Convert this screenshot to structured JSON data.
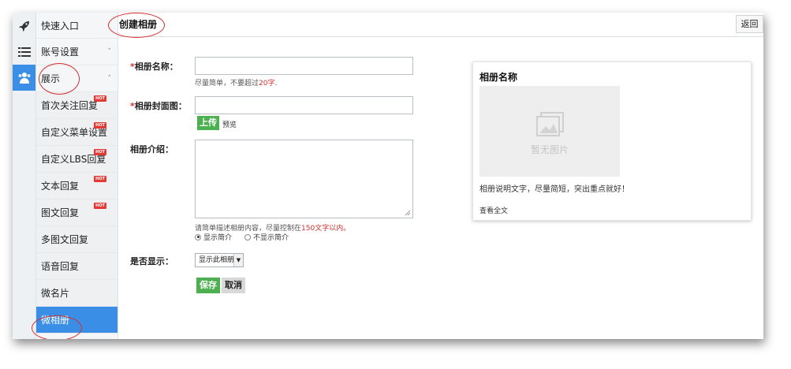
{
  "sidebar": {
    "rail_icons": [
      {
        "icon": "rocket-icon"
      },
      {
        "icon": "list-icon"
      },
      {
        "icon": "users-icon",
        "active": true
      }
    ],
    "items": [
      {
        "label": "快速入口"
      },
      {
        "label": "账号设置",
        "chevron": "˅"
      },
      {
        "label": "展示",
        "chevron": "˄"
      },
      {
        "label": "首次关注回复",
        "badge": "HOT"
      },
      {
        "label": "自定义菜单设置",
        "badge": "HOT"
      },
      {
        "label": "自定义LBS回复",
        "badge": "HOT"
      },
      {
        "label": "文本回复",
        "badge": "HOT"
      },
      {
        "label": "图文回复",
        "badge": "HOT"
      },
      {
        "label": "多图文回复"
      },
      {
        "label": "语音回复"
      },
      {
        "label": "微名片"
      },
      {
        "label": "微相册",
        "active": true
      }
    ]
  },
  "header": {
    "title": "创建相册",
    "back_label": "返回"
  },
  "form": {
    "name_label_req": "*",
    "name_label": "相册名称：",
    "name_value": "",
    "name_hint_pre": "尽量简单，不要超过",
    "name_hint_red": "20字",
    "name_hint_post": ".",
    "cover_label_req": "*",
    "cover_label": "相册封面图：",
    "cover_value": "",
    "upload_label": "上传",
    "preview_label": "预览",
    "intro_label": "相册介绍：",
    "intro_value": "",
    "intro_hint_pre": "请简单描述相册内容，尽量控制在",
    "intro_hint_red": "150文字以内。",
    "radio_show": "显示简介",
    "radio_hide": "不显示简介",
    "display_label": "是否显示：",
    "display_selected": "显示此相册",
    "save_label": "保存",
    "cancel_label": "取消"
  },
  "preview": {
    "title": "相册名称",
    "no_image": "暂无图片",
    "desc": "相册说明文字，尽量简短，突出重点就好！",
    "more": "查看全文"
  },
  "colors": {
    "accent": "#3a8ee6",
    "annotation": "#d32f2f",
    "green": "#4caf50",
    "hot": "#e53935"
  }
}
